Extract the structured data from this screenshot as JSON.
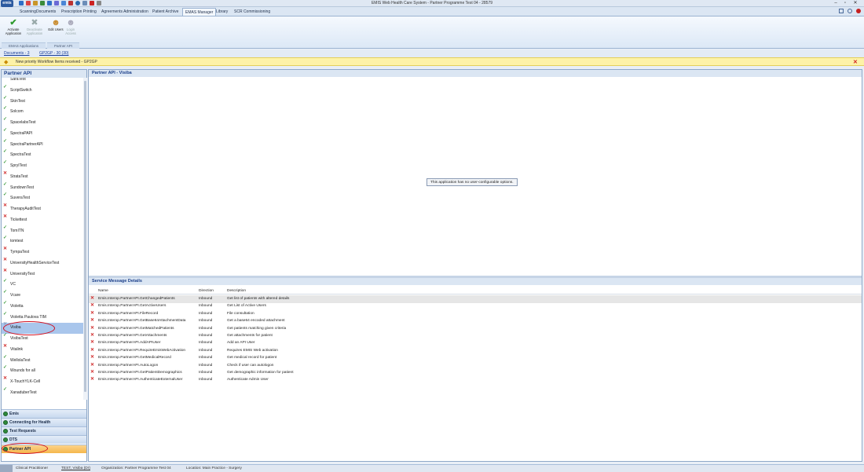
{
  "window": {
    "title": "EMIS Web Health Care System - Partner Programme Test 04 - 28579",
    "minimize": "–",
    "restore": "▫",
    "close": "✕"
  },
  "ribbon_tabs": [
    "Scanning",
    "Documents",
    "Prescription Printing",
    "Agreements Administration",
    "Patient Archive",
    "EMAS Manager",
    "Library",
    "SCR Commissioning"
  ],
  "active_tab": "EMAS Manager",
  "ribbon": {
    "buttons": [
      {
        "label": "Activate Application",
        "icon": "green-check-icon",
        "enabled": true
      },
      {
        "label": "Deactivate Application",
        "icon": "red-x-icon",
        "enabled": false
      },
      {
        "label": "Edit Users",
        "icon": "users-icon",
        "enabled": true
      },
      {
        "label": "Login Access",
        "icon": "login-icon",
        "enabled": false
      }
    ],
    "groups": [
      "EMAS Applications",
      "Partner API"
    ]
  },
  "docbar": {
    "documents": "Documents - 3",
    "gp2gp": "GP2GP - 30 (30)"
  },
  "notification": {
    "text": "New priority Workflow Items received - GP2GP",
    "close": "✕"
  },
  "left_panel": {
    "title": "Partner API",
    "items": [
      {
        "label": "SaraTest",
        "status": "ok"
      },
      {
        "label": "ScriptSwitch",
        "status": "ok"
      },
      {
        "label": "SkinTest",
        "status": "ok"
      },
      {
        "label": "Solcom",
        "status": "ok"
      },
      {
        "label": "SpacelabsTest",
        "status": "ok"
      },
      {
        "label": "SpectraPAPI",
        "status": "ok"
      },
      {
        "label": "SpectraPartnerAPI",
        "status": "ok"
      },
      {
        "label": "SpectraTest",
        "status": "ok"
      },
      {
        "label": "SpryITest",
        "status": "ok"
      },
      {
        "label": "StrataTest",
        "status": "bad"
      },
      {
        "label": "SundownTest",
        "status": "ok"
      },
      {
        "label": "SuveraTest",
        "status": "ok"
      },
      {
        "label": "TherapyAuditTest",
        "status": "bad"
      },
      {
        "label": "Tickettest",
        "status": "bad"
      },
      {
        "label": "TomITN",
        "status": "ok"
      },
      {
        "label": "tomtest",
        "status": "ok"
      },
      {
        "label": "TympaTest",
        "status": "bad"
      },
      {
        "label": "UniversityHealthServiceTest",
        "status": "bad"
      },
      {
        "label": "UniversityTest",
        "status": "bad"
      },
      {
        "label": "VC",
        "status": "ok"
      },
      {
        "label": "Vcare",
        "status": "ok"
      },
      {
        "label": "Violetta",
        "status": "ok"
      },
      {
        "label": "Violetta Paulova TIM",
        "status": "ok"
      },
      {
        "label": "Visiba",
        "status": "sel"
      },
      {
        "label": "VisibaTest",
        "status": "ok"
      },
      {
        "label": "Vitalink",
        "status": "bad"
      },
      {
        "label": "WellolaTest",
        "status": "ok"
      },
      {
        "label": "Wounds for all",
        "status": "ok"
      },
      {
        "label": "X-TouchYLK-Cell",
        "status": "bad"
      },
      {
        "label": "XanaduberTest",
        "status": "ok"
      }
    ],
    "nav": [
      "Emis",
      "Connecting for Health",
      "Test Requests",
      "DTS",
      "Partner API"
    ],
    "active_nav": "Partner API"
  },
  "main": {
    "title": "Partner API - Visiba",
    "no_options_message": "This application has no user-configurable options.",
    "details_title": "Service Message Details",
    "columns": [
      "Name",
      "Direction",
      "Description"
    ],
    "rows": [
      {
        "name": "Emis.Interop.PartnerAPI.GetChangedPatients",
        "direction": "Inbound",
        "description": "Get list of patients with altered details"
      },
      {
        "name": "Emis.Interop.PartnerAPI.GetActiveUsers",
        "direction": "Inbound",
        "description": "Get List of Active Users"
      },
      {
        "name": "Emis.Interop.PartnerAPI.FileRecord",
        "direction": "Inbound",
        "description": "File consultation"
      },
      {
        "name": "Emis.Interop.PartnerAPI.GetBase64AttachmentData",
        "direction": "Inbound",
        "description": "Get a base64 encoded attachment"
      },
      {
        "name": "Emis.Interop.PartnerAPI.GetMatchedPatients",
        "direction": "Inbound",
        "description": "Get patients matching given criteria"
      },
      {
        "name": "Emis.Interop.PartnerAPI.GetAttachments",
        "direction": "Inbound",
        "description": "Get attachments for patient"
      },
      {
        "name": "Emis.Interop.PartnerAPI.AddAPIUser",
        "direction": "Inbound",
        "description": "Add an API User"
      },
      {
        "name": "Emis.Interop.PartnerAPI.RequireEmisWebActivation",
        "direction": "Inbound",
        "description": "Requires EMIS Web activation"
      },
      {
        "name": "Emis.Interop.PartnerAPI.GetMedicalRecord",
        "direction": "Inbound",
        "description": "Get medical record for patient"
      },
      {
        "name": "Emis.Interop.PartnerAPI.AutoLogon",
        "direction": "Inbound",
        "description": "Check if user can autologon"
      },
      {
        "name": "Emis.Interop.PartnerAPI.GetPatientDemographics",
        "direction": "Inbound",
        "description": "Get demographic information for patient"
      },
      {
        "name": "Emis.Interop.PartnerAPI.AuthenticateExternalUser",
        "direction": "Inbound",
        "description": "Authenticate Admin User"
      }
    ]
  },
  "statusbar": {
    "role": "Clinical Practitioner",
    "user": "TEST, Visiba (Dr)",
    "organisation": "Organization: Partner Programme Test 04",
    "location": "Location: Main Practice - Surgery"
  },
  "colors": {
    "accent": "#1b3f8a",
    "selection": "#a9c6ec",
    "highlight_circle": "#d01020",
    "notification": "#fdf2a8"
  }
}
